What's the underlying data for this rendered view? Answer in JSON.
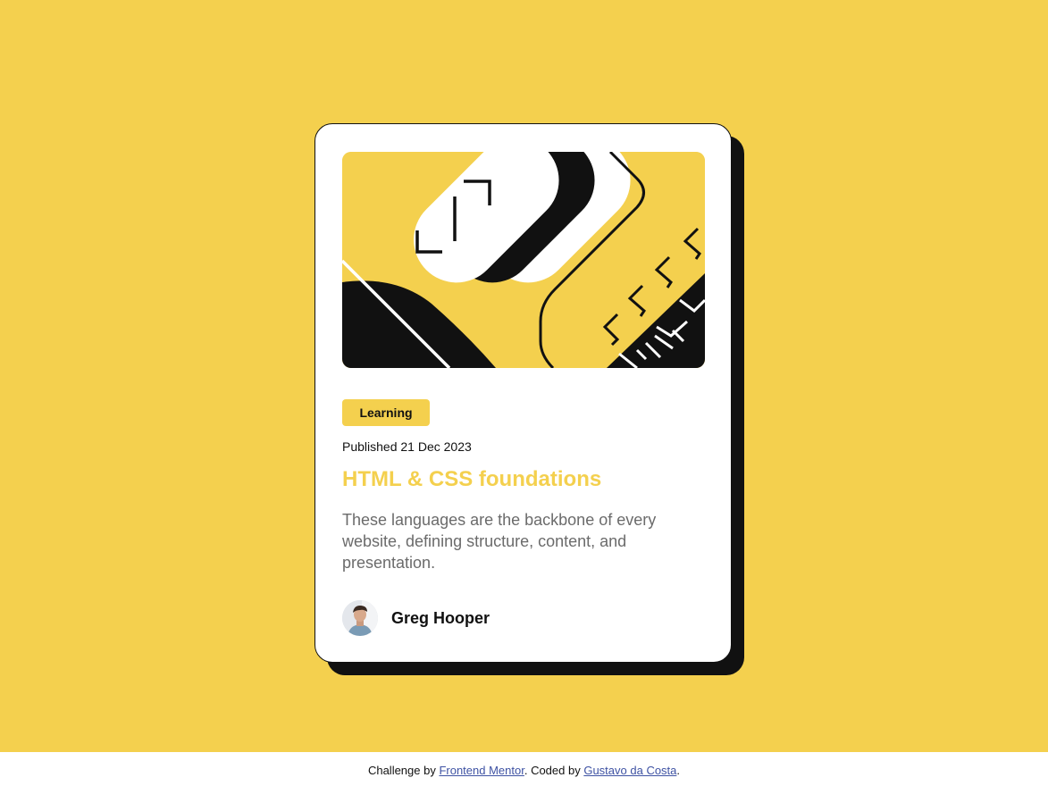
{
  "colors": {
    "background": "#F4D04E",
    "card": "#FFFFFF",
    "ink": "#111111",
    "accent_text": "#F4D04E",
    "muted_text": "#6B6B6B",
    "link": "#3E52A3"
  },
  "card": {
    "illustration_icon": "abstract-illustration",
    "tag": "Learning",
    "published": "Published 21 Dec 2023",
    "title": "HTML & CSS foundations",
    "description": "These languages are the backbone of every website, defining structure, content, and presentation.",
    "author": {
      "avatar_icon": "person-avatar",
      "name": "Greg Hooper"
    }
  },
  "footer": {
    "prefix": "Challenge by ",
    "link1": "Frontend Mentor",
    "middle": ". Coded by ",
    "link2": "Gustavo da Costa",
    "suffix": "."
  }
}
